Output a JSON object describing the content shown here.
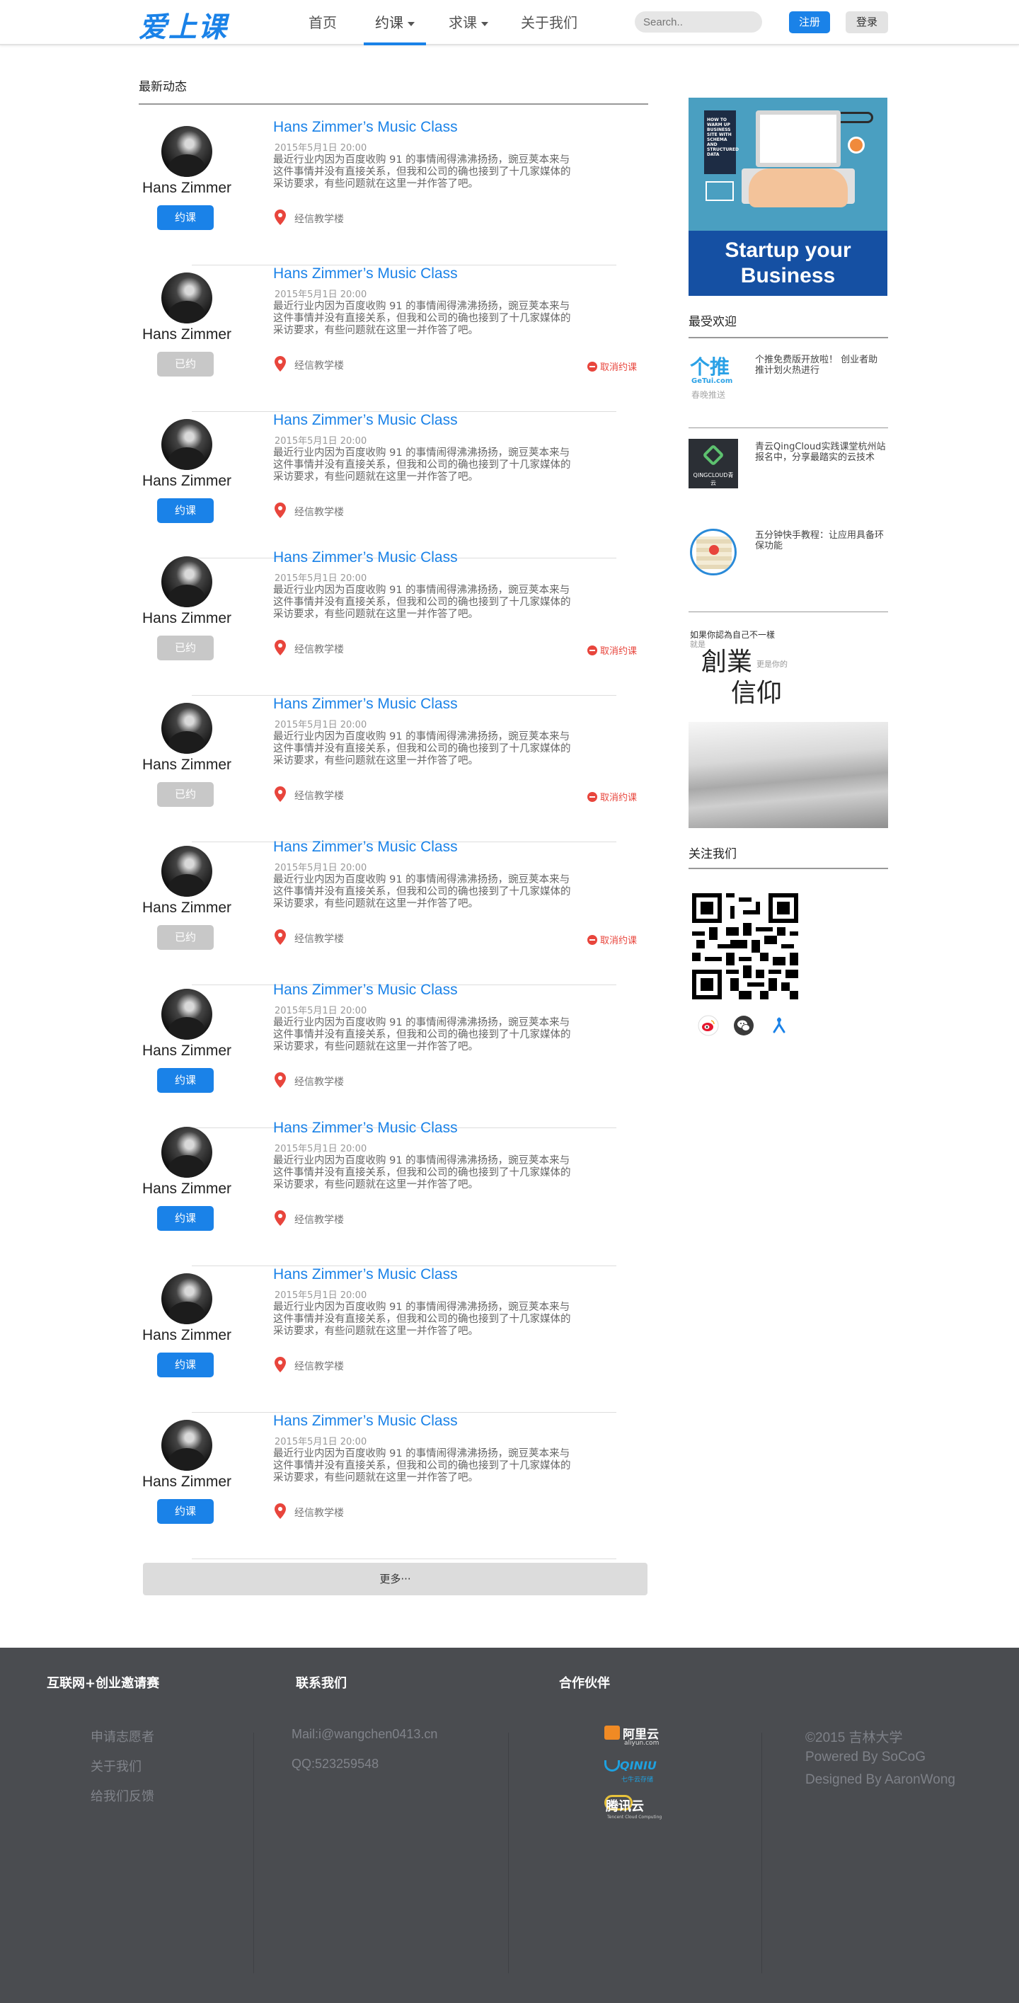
{
  "header": {
    "logo": "爱上课",
    "nav": [
      {
        "label": "首页"
      },
      {
        "label": "约课"
      },
      {
        "label": "求课"
      },
      {
        "label": "关于我们"
      }
    ],
    "search_placeholder": "Search..",
    "register_label": "注册",
    "login_label": "登录"
  },
  "main": {
    "section_title": "最新动态",
    "more_label": "更多···",
    "cards": [
      {
        "author": "Hans Zimmer",
        "title": "Hans Zimmer’s Music Class",
        "date": "2015年5月1日 20:00",
        "desc": "最近行业内因为百度收购 91 的事情闹得沸沸扬扬，豌豆荚本来与这件事情并没有直接关系，但我和公司的确也接到了十几家媒体的采访要求，有些问题就在这里一并作答了吧。",
        "location": "经信教学楼",
        "button": "约课",
        "booked": false,
        "cancel": ""
      },
      {
        "author": "Hans Zimmer",
        "title": "Hans Zimmer’s Music Class",
        "date": "2015年5月1日 20:00",
        "desc": "最近行业内因为百度收购 91 的事情闹得沸沸扬扬，豌豆荚本来与这件事情并没有直接关系，但我和公司的确也接到了十几家媒体的采访要求，有些问题就在这里一并作答了吧。",
        "location": "经信教学楼",
        "button": "已约",
        "booked": true,
        "cancel": "取消约课"
      },
      {
        "author": "Hans Zimmer",
        "title": "Hans Zimmer’s Music Class",
        "date": "2015年5月1日 20:00",
        "desc": "最近行业内因为百度收购 91 的事情闹得沸沸扬扬，豌豆荚本来与这件事情并没有直接关系，但我和公司的确也接到了十几家媒体的采访要求，有些问题就在这里一并作答了吧。",
        "location": "经信教学楼",
        "button": "约课",
        "booked": false,
        "cancel": ""
      },
      {
        "author": "Hans Zimmer",
        "title": "Hans Zimmer’s Music Class",
        "date": "2015年5月1日 20:00",
        "desc": "最近行业内因为百度收购 91 的事情闹得沸沸扬扬，豌豆荚本来与这件事情并没有直接关系，但我和公司的确也接到了十几家媒体的采访要求，有些问题就在这里一并作答了吧。",
        "location": "经信教学楼",
        "button": "已约",
        "booked": true,
        "cancel": "取消约课"
      },
      {
        "author": "Hans Zimmer",
        "title": "Hans Zimmer’s Music Class",
        "date": "2015年5月1日 20:00",
        "desc": "最近行业内因为百度收购 91 的事情闹得沸沸扬扬，豌豆荚本来与这件事情并没有直接关系，但我和公司的确也接到了十几家媒体的采访要求，有些问题就在这里一并作答了吧。",
        "location": "经信教学楼",
        "button": "已约",
        "booked": true,
        "cancel": "取消约课"
      },
      {
        "author": "Hans Zimmer",
        "title": "Hans Zimmer’s Music Class",
        "date": "2015年5月1日 20:00",
        "desc": "最近行业内因为百度收购 91 的事情闹得沸沸扬扬，豌豆荚本来与这件事情并没有直接关系，但我和公司的确也接到了十几家媒体的采访要求，有些问题就在这里一并作答了吧。",
        "location": "经信教学楼",
        "button": "已约",
        "booked": true,
        "cancel": "取消约课"
      },
      {
        "author": "Hans Zimmer",
        "title": "Hans Zimmer’s Music Class",
        "date": "2015年5月1日 20:00",
        "desc": "最近行业内因为百度收购 91 的事情闹得沸沸扬扬，豌豆荚本来与这件事情并没有直接关系，但我和公司的确也接到了十几家媒体的采访要求，有些问题就在这里一并作答了吧。",
        "location": "经信教学楼",
        "button": "约课",
        "booked": false,
        "cancel": ""
      },
      {
        "author": "Hans Zimmer",
        "title": "Hans Zimmer’s Music Class",
        "date": "2015年5月1日 20:00",
        "desc": "最近行业内因为百度收购 91 的事情闹得沸沸扬扬，豌豆荚本来与这件事情并没有直接关系，但我和公司的确也接到了十几家媒体的采访要求，有些问题就在这里一并作答了吧。",
        "location": "经信教学楼",
        "button": "约课",
        "booked": false,
        "cancel": ""
      },
      {
        "author": "Hans Zimmer",
        "title": "Hans Zimmer’s Music Class",
        "date": "2015年5月1日 20:00",
        "desc": "最近行业内因为百度收购 91 的事情闹得沸沸扬扬，豌豆荚本来与这件事情并没有直接关系，但我和公司的确也接到了十几家媒体的采访要求，有些问题就在这里一并作答了吧。",
        "location": "经信教学楼",
        "button": "约课",
        "booked": false,
        "cancel": ""
      },
      {
        "author": "Hans Zimmer",
        "title": "Hans Zimmer’s Music Class",
        "date": "2015年5月1日 20:00",
        "desc": "最近行业内因为百度收购 91 的事情闹得沸沸扬扬，豌豆荚本来与这件事情并没有直接关系，但我和公司的确也接到了十几家媒体的采访要求，有些问题就在这里一并作答了吧。",
        "location": "经信教学楼",
        "button": "约课",
        "booked": false,
        "cancel": ""
      }
    ]
  },
  "sidebar": {
    "ad1": {
      "book_text": "HOW TO WARM UP BUSINESS SITE WITH SCHEMA AND STRUCTURED DATA",
      "banner": "Startup your Business"
    },
    "popular_title": "最受欢迎",
    "popular": [
      {
        "thumb_text": "个推",
        "thumb_sub": "GeTui.com",
        "thumb_sub2": "春晚推送",
        "text": "个推免费版开放啦！ 创业者助推计划火热进行"
      },
      {
        "thumb_text": "QINGCLOUD青云",
        "text": "青云QingCloud实践课堂杭州站报名中，分享最踏实的云技术"
      },
      {
        "thumb_text": "",
        "text": "五分钟快手教程：让应用具备环保功能"
      }
    ],
    "ad2": {
      "line1": "如果你認為自己不一樣",
      "line2": "就是",
      "line3": "創業",
      "line4": "更是你的",
      "line5": "信仰"
    },
    "follow_title": "关注我们",
    "social": [
      "weibo-icon",
      "wechat-icon",
      "renren-icon"
    ]
  },
  "footer": {
    "col1": {
      "title": "互联网+创业邀请赛",
      "links": [
        "申请志愿者",
        "关于我们",
        "给我们反馈"
      ]
    },
    "col2": {
      "title": "联系我们",
      "mail": "Mail:i@wangchen0413.cn",
      "qq": "QQ:523259548"
    },
    "col3": {
      "title": "合作伙伴",
      "partners": [
        {
          "name": "阿里云",
          "sub": "aliyun.com"
        },
        {
          "name": "QINIU",
          "sub": "七牛云存储"
        },
        {
          "name": "腾讯云",
          "sub": "Tencent Cloud Computing"
        }
      ]
    },
    "col4": {
      "line1": "©2015 吉林大学",
      "line2": "Powered By SoCoG",
      "line3": "Designed By AaronWong"
    }
  },
  "colors": {
    "accent": "#1a82e8",
    "danger": "#e8453c",
    "footer_bg": "#4a4c50",
    "booked_btn": "#c8c8c8"
  }
}
